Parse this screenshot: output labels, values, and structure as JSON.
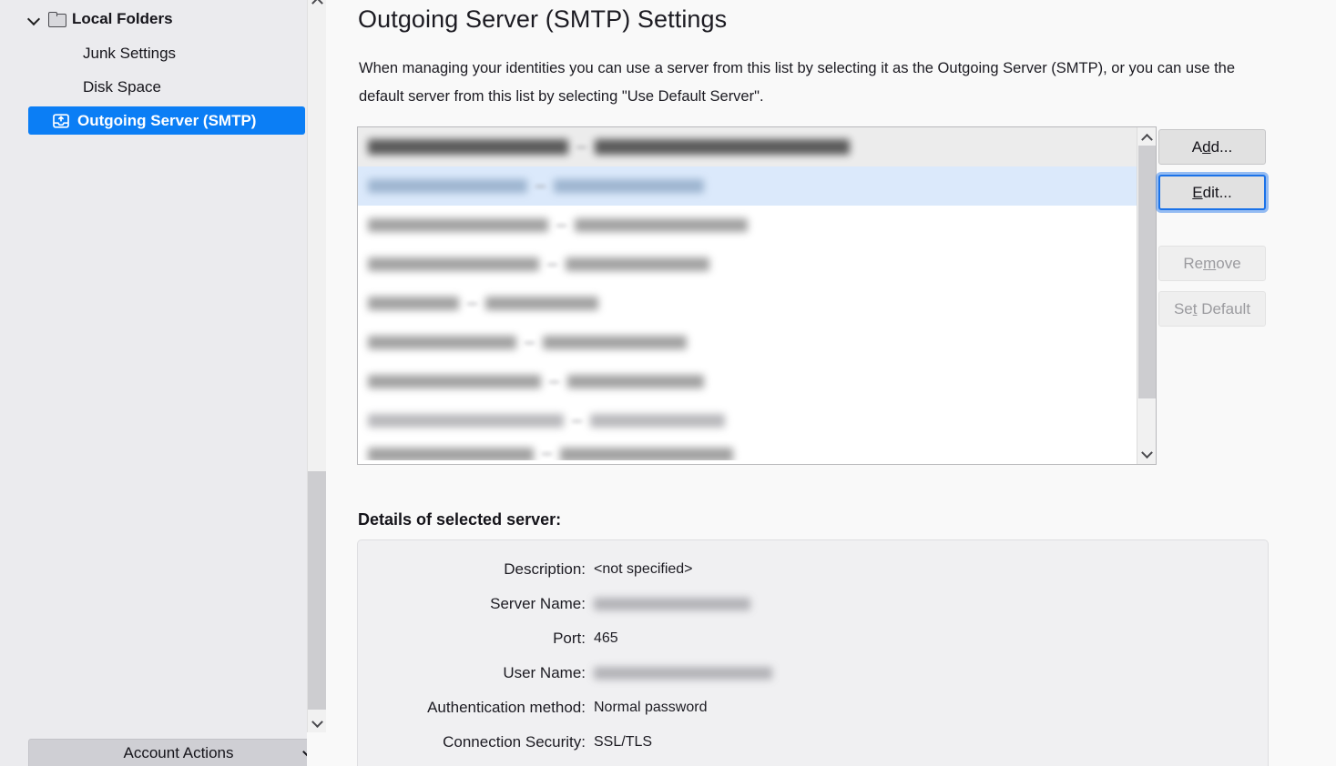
{
  "sidebar": {
    "root": {
      "label": "Local Folders",
      "icon": "folder-icon",
      "twisty": "chevron-down-icon",
      "expanded": true
    },
    "items": [
      {
        "label": "Junk Settings",
        "selected": false
      },
      {
        "label": "Disk Space",
        "selected": false
      },
      {
        "label": "Outgoing Server (SMTP)",
        "selected": true,
        "icon": "outgoing-server-icon"
      }
    ],
    "account_actions": {
      "label": "Account Actions",
      "icon": "chevron-down-icon"
    },
    "scrollbar": {
      "up_icon": "chevron-up-icon",
      "down_icon": "chevron-down-icon"
    }
  },
  "main": {
    "title": "Outgoing Server (SMTP) Settings",
    "intro": "When managing your identities you can use a server from this list by selecting it as the Outgoing Server (SMTP), or you can use the default server from this list by selecting \"Use Default Server\".",
    "server_list": {
      "scrollbar": {
        "up_icon": "chevron-up-icon",
        "down_icon": "chevron-down-icon"
      },
      "rows": [
        {
          "state": "default",
          "redacted": true,
          "widths": [
            220,
            280
          ]
        },
        {
          "state": "selected",
          "redacted": true,
          "widths": [
            175,
            165
          ]
        },
        {
          "state": "normal",
          "redacted": true,
          "widths": [
            198,
            190
          ]
        },
        {
          "state": "normal",
          "redacted": true,
          "widths": [
            188,
            158
          ]
        },
        {
          "state": "normal",
          "redacted": true,
          "widths": [
            100,
            124
          ]
        },
        {
          "state": "normal",
          "redacted": true,
          "widths": [
            163,
            158
          ]
        },
        {
          "state": "normal",
          "redacted": true,
          "widths": [
            190,
            150
          ]
        },
        {
          "state": "normal",
          "redacted": true,
          "widths": [
            215,
            148
          ]
        },
        {
          "state": "clipped",
          "redacted": true,
          "widths": [
            182,
            190
          ]
        }
      ]
    },
    "buttons": {
      "add": {
        "label": "Add...",
        "accesskey": "d",
        "state": "enabled"
      },
      "edit": {
        "label": "Edit...",
        "accesskey": "E",
        "state": "focused"
      },
      "remove": {
        "label": "Remove",
        "accesskey": "m",
        "state": "disabled"
      },
      "set_default": {
        "label": "Set Default",
        "accesskey": "t",
        "state": "disabled"
      }
    },
    "details": {
      "title": "Details of selected server:",
      "fields": [
        {
          "label": "Description:",
          "value": "<not specified>",
          "redacted": false
        },
        {
          "label": "Server Name:",
          "value": "",
          "redacted": true,
          "width": 172
        },
        {
          "label": "Port:",
          "value": "465",
          "redacted": false
        },
        {
          "label": "User Name:",
          "value": "",
          "redacted": true,
          "width": 196
        },
        {
          "label": "Authentication method:",
          "value": "Normal password",
          "redacted": false
        },
        {
          "label": "Connection Security:",
          "value": "SSL/TLS",
          "redacted": false
        }
      ]
    }
  },
  "colors": {
    "accent": "#0b7ef5",
    "selection_row": "#dbe9fb",
    "focus_ring": "#1b72e8",
    "sidebar_bg": "#ebebee",
    "main_bg": "#f9f9f9",
    "panel_bg": "#f0f0f2"
  }
}
